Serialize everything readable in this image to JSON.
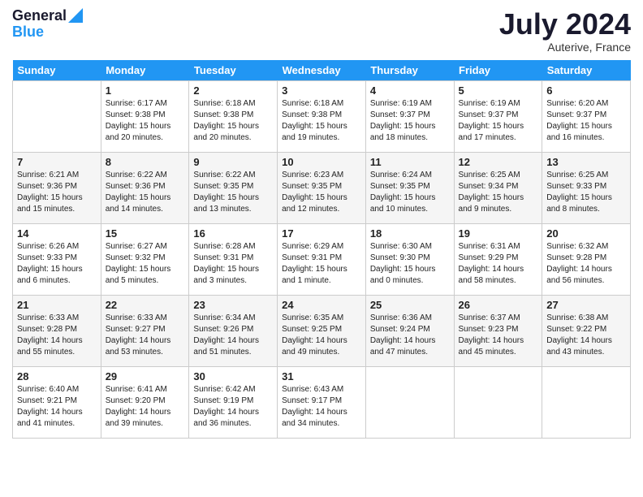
{
  "logo": {
    "line1": "General",
    "line2": "Blue"
  },
  "title": "July 2024",
  "subtitle": "Auterive, France",
  "days_of_week": [
    "Sunday",
    "Monday",
    "Tuesday",
    "Wednesday",
    "Thursday",
    "Friday",
    "Saturday"
  ],
  "weeks": [
    [
      {
        "day": "",
        "info": ""
      },
      {
        "day": "1",
        "info": "Sunrise: 6:17 AM\nSunset: 9:38 PM\nDaylight: 15 hours\nand 20 minutes."
      },
      {
        "day": "2",
        "info": "Sunrise: 6:18 AM\nSunset: 9:38 PM\nDaylight: 15 hours\nand 20 minutes."
      },
      {
        "day": "3",
        "info": "Sunrise: 6:18 AM\nSunset: 9:38 PM\nDaylight: 15 hours\nand 19 minutes."
      },
      {
        "day": "4",
        "info": "Sunrise: 6:19 AM\nSunset: 9:37 PM\nDaylight: 15 hours\nand 18 minutes."
      },
      {
        "day": "5",
        "info": "Sunrise: 6:19 AM\nSunset: 9:37 PM\nDaylight: 15 hours\nand 17 minutes."
      },
      {
        "day": "6",
        "info": "Sunrise: 6:20 AM\nSunset: 9:37 PM\nDaylight: 15 hours\nand 16 minutes."
      }
    ],
    [
      {
        "day": "7",
        "info": "Sunrise: 6:21 AM\nSunset: 9:36 PM\nDaylight: 15 hours\nand 15 minutes."
      },
      {
        "day": "8",
        "info": "Sunrise: 6:22 AM\nSunset: 9:36 PM\nDaylight: 15 hours\nand 14 minutes."
      },
      {
        "day": "9",
        "info": "Sunrise: 6:22 AM\nSunset: 9:35 PM\nDaylight: 15 hours\nand 13 minutes."
      },
      {
        "day": "10",
        "info": "Sunrise: 6:23 AM\nSunset: 9:35 PM\nDaylight: 15 hours\nand 12 minutes."
      },
      {
        "day": "11",
        "info": "Sunrise: 6:24 AM\nSunset: 9:35 PM\nDaylight: 15 hours\nand 10 minutes."
      },
      {
        "day": "12",
        "info": "Sunrise: 6:25 AM\nSunset: 9:34 PM\nDaylight: 15 hours\nand 9 minutes."
      },
      {
        "day": "13",
        "info": "Sunrise: 6:25 AM\nSunset: 9:33 PM\nDaylight: 15 hours\nand 8 minutes."
      }
    ],
    [
      {
        "day": "14",
        "info": "Sunrise: 6:26 AM\nSunset: 9:33 PM\nDaylight: 15 hours\nand 6 minutes."
      },
      {
        "day": "15",
        "info": "Sunrise: 6:27 AM\nSunset: 9:32 PM\nDaylight: 15 hours\nand 5 minutes."
      },
      {
        "day": "16",
        "info": "Sunrise: 6:28 AM\nSunset: 9:31 PM\nDaylight: 15 hours\nand 3 minutes."
      },
      {
        "day": "17",
        "info": "Sunrise: 6:29 AM\nSunset: 9:31 PM\nDaylight: 15 hours\nand 1 minute."
      },
      {
        "day": "18",
        "info": "Sunrise: 6:30 AM\nSunset: 9:30 PM\nDaylight: 15 hours\nand 0 minutes."
      },
      {
        "day": "19",
        "info": "Sunrise: 6:31 AM\nSunset: 9:29 PM\nDaylight: 14 hours\nand 58 minutes."
      },
      {
        "day": "20",
        "info": "Sunrise: 6:32 AM\nSunset: 9:28 PM\nDaylight: 14 hours\nand 56 minutes."
      }
    ],
    [
      {
        "day": "21",
        "info": "Sunrise: 6:33 AM\nSunset: 9:28 PM\nDaylight: 14 hours\nand 55 minutes."
      },
      {
        "day": "22",
        "info": "Sunrise: 6:33 AM\nSunset: 9:27 PM\nDaylight: 14 hours\nand 53 minutes."
      },
      {
        "day": "23",
        "info": "Sunrise: 6:34 AM\nSunset: 9:26 PM\nDaylight: 14 hours\nand 51 minutes."
      },
      {
        "day": "24",
        "info": "Sunrise: 6:35 AM\nSunset: 9:25 PM\nDaylight: 14 hours\nand 49 minutes."
      },
      {
        "day": "25",
        "info": "Sunrise: 6:36 AM\nSunset: 9:24 PM\nDaylight: 14 hours\nand 47 minutes."
      },
      {
        "day": "26",
        "info": "Sunrise: 6:37 AM\nSunset: 9:23 PM\nDaylight: 14 hours\nand 45 minutes."
      },
      {
        "day": "27",
        "info": "Sunrise: 6:38 AM\nSunset: 9:22 PM\nDaylight: 14 hours\nand 43 minutes."
      }
    ],
    [
      {
        "day": "28",
        "info": "Sunrise: 6:40 AM\nSunset: 9:21 PM\nDaylight: 14 hours\nand 41 minutes."
      },
      {
        "day": "29",
        "info": "Sunrise: 6:41 AM\nSunset: 9:20 PM\nDaylight: 14 hours\nand 39 minutes."
      },
      {
        "day": "30",
        "info": "Sunrise: 6:42 AM\nSunset: 9:19 PM\nDaylight: 14 hours\nand 36 minutes."
      },
      {
        "day": "31",
        "info": "Sunrise: 6:43 AM\nSunset: 9:17 PM\nDaylight: 14 hours\nand 34 minutes."
      },
      {
        "day": "",
        "info": ""
      },
      {
        "day": "",
        "info": ""
      },
      {
        "day": "",
        "info": ""
      }
    ]
  ]
}
